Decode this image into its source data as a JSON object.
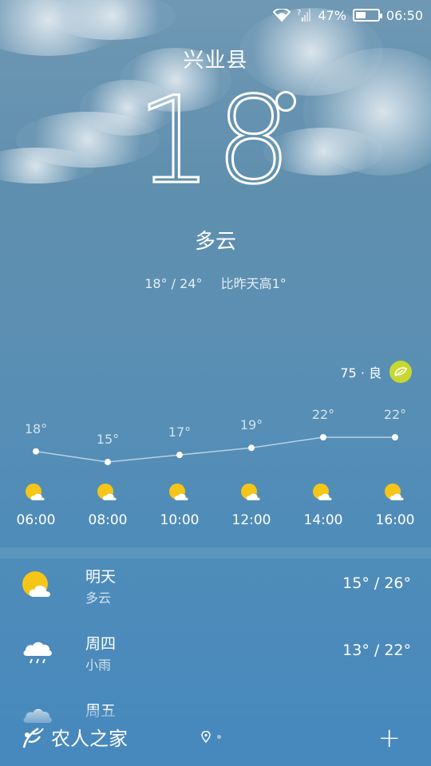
{
  "status_bar": {
    "battery": "47%",
    "battery_level": 0.47,
    "time": "06:50"
  },
  "current": {
    "city": "兴业县",
    "temperature": "18",
    "condition": "多云",
    "range": "18° / 24°",
    "compare": "比昨天高1°"
  },
  "aqi": {
    "text": "75 · 良",
    "icon": "leaf-icon",
    "color": "#c7d930"
  },
  "hourly": [
    {
      "time": "06:00",
      "temp": "18°",
      "value": 18,
      "icon": "partly-cloudy-icon"
    },
    {
      "time": "08:00",
      "temp": "15°",
      "value": 15,
      "icon": "partly-cloudy-icon"
    },
    {
      "time": "10:00",
      "temp": "17°",
      "value": 17,
      "icon": "partly-cloudy-icon"
    },
    {
      "time": "12:00",
      "temp": "19°",
      "value": 19,
      "icon": "partly-cloudy-icon"
    },
    {
      "time": "14:00",
      "temp": "22°",
      "value": 22,
      "icon": "partly-cloudy-icon"
    },
    {
      "time": "16:00",
      "temp": "22°",
      "value": 22,
      "icon": "partly-cloudy-icon"
    }
  ],
  "daily": [
    {
      "day": "明天",
      "condition": "多云",
      "range": "15° / 26°",
      "icon": "partly-cloudy-icon"
    },
    {
      "day": "周四",
      "condition": "小雨",
      "range": "13° / 22°",
      "icon": "light-rain-icon"
    },
    {
      "day": "周五",
      "condition": "",
      "range": "",
      "icon": "partly-cloudy-icon"
    }
  ],
  "footer": {
    "logo_text": "农人之家",
    "add_label": "+"
  }
}
